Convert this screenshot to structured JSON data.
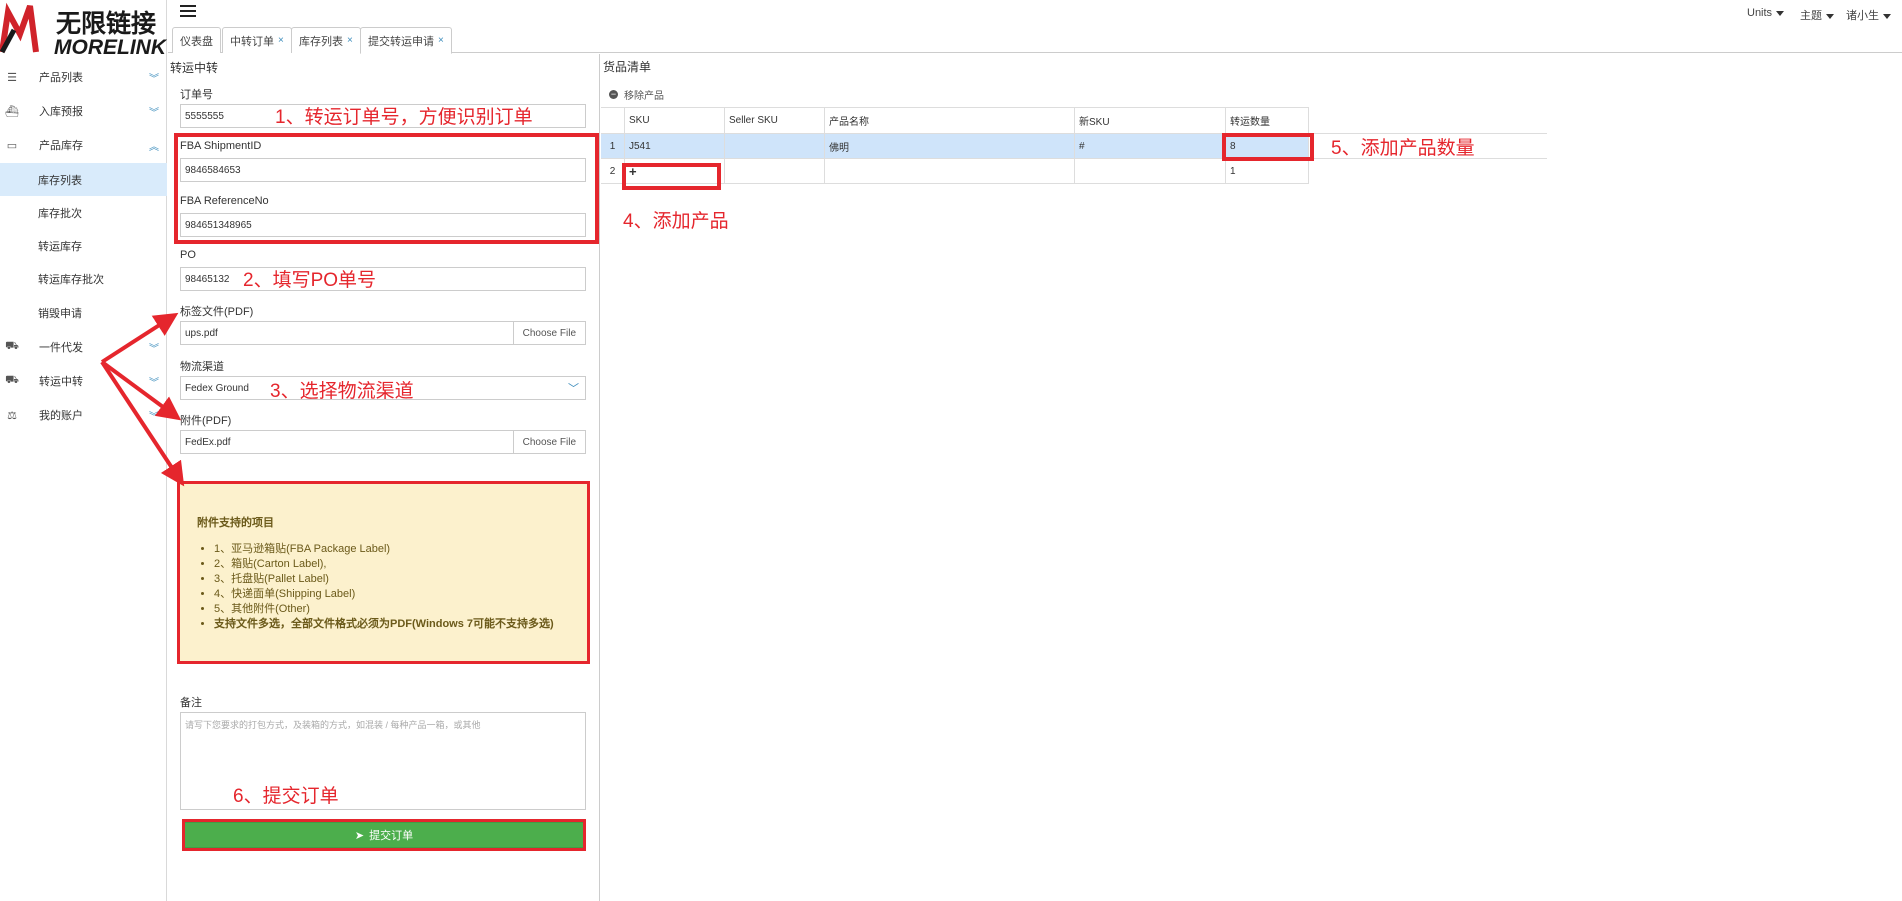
{
  "logo": {
    "cn": "无限链接",
    "en": "MORELINK"
  },
  "sidebar": {
    "items": [
      {
        "label": "产品列表",
        "icon": "list-icon"
      },
      {
        "label": "入库预报",
        "icon": "ship-icon"
      },
      {
        "label": "产品库存",
        "icon": "inbox-icon"
      },
      {
        "label": "一件代发",
        "icon": "truck-icon"
      },
      {
        "label": "转运中转",
        "icon": "truck-icon"
      },
      {
        "label": "我的账户",
        "icon": "balance-icon"
      }
    ],
    "subitems": [
      "库存列表",
      "库存批次",
      "转运库存",
      "转运库存批次",
      "销毁申请"
    ]
  },
  "topbar": {
    "units": "Units",
    "theme": "主题",
    "user": "诸小生"
  },
  "tabs": [
    "仪表盘",
    "中转订单",
    "库存列表",
    "提交转运申请"
  ],
  "form": {
    "panel_title": "转运中转",
    "order_label": "订单号",
    "order_value": "5555555",
    "fba_shipment_label": "FBA ShipmentID",
    "fba_shipment_value": "9846584653",
    "fba_ref_label": "FBA ReferenceNo",
    "fba_ref_value": "984651348965",
    "po_label": "PO",
    "po_value": "98465132",
    "label_file_label": "标签文件(PDF)",
    "label_file_value": "ups.pdf",
    "choose_file": "Choose File",
    "channel_label": "物流渠道",
    "channel_value": "Fedex Ground",
    "attach_label": "附件(PDF)",
    "attach_value": "FedEx.pdf",
    "note_title": "附件支持的项目",
    "note_items": [
      "1、亚马逊箱贴(FBA Package Label)",
      "2、箱贴(Carton Label),",
      "3、托盘贴(Pallet Label)",
      "4、快递面单(Shipping Label)",
      "5、其他附件(Other)"
    ],
    "note_bold": "支持文件多选，全部文件格式必须为PDF(Windows 7可能不支持多选)",
    "remark_label": "备注",
    "remark_placeholder": "请写下您要求的打包方式，及装箱的方式，如混装 / 每种产品一箱，或其他",
    "submit_label": "提交订单"
  },
  "goods": {
    "title": "货品清单",
    "remove_label": "移除产品",
    "headers": [
      "",
      "SKU",
      "Seller SKU",
      "产品名称",
      "新SKU",
      "转运数量"
    ],
    "rows": [
      [
        "1",
        "J541",
        "",
        "佛明",
        "#",
        "8"
      ],
      [
        "2",
        "+",
        "",
        "",
        "",
        "1"
      ]
    ]
  },
  "annotations": {
    "a1": "1、转运订单号，方便识别订单",
    "a2": "2、填写PO单号",
    "a3": "3、选择物流渠道",
    "a4": "4、添加产品",
    "a5": "5、添加产品数量",
    "a6": "6、提交订单"
  },
  "colors": {
    "annotation_red": "#e5262d",
    "submit_green": "#4cae4c",
    "active_blue": "#d9ebfb",
    "note_yellow": "#fcf1cd"
  }
}
